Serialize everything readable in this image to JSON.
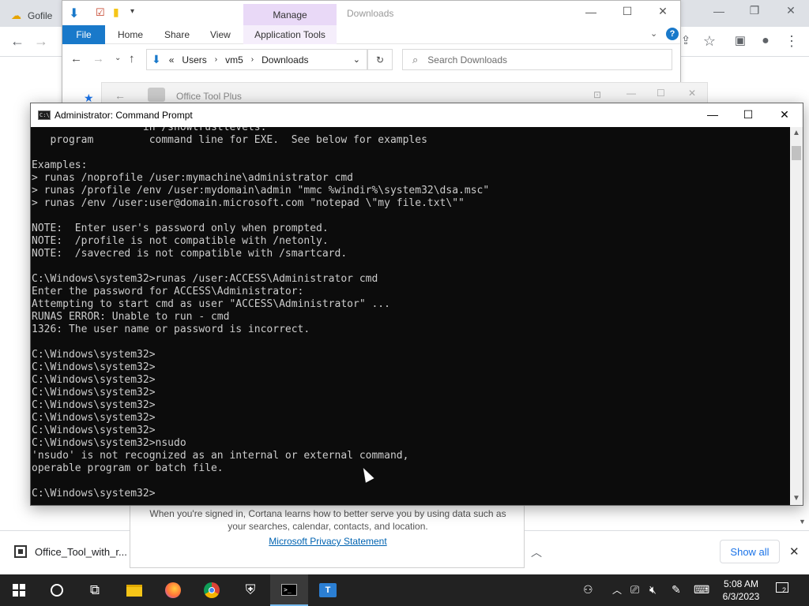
{
  "chrome": {
    "tab_title": "Gofile",
    "downloads": {
      "file_name": "Office_Tool_with_r...",
      "show_all": "Show all"
    }
  },
  "explorer": {
    "manage_label": "Manage",
    "title": "Downloads",
    "tabs": [
      "File",
      "Home",
      "Share",
      "View",
      "Application Tools"
    ],
    "breadcrumb": [
      "«",
      "Users",
      "vm5",
      "Downloads"
    ],
    "search_placeholder": "Search Downloads"
  },
  "office_tool": {
    "title": "Office Tool Plus"
  },
  "cortana": {
    "text": "When you're signed in, Cortana learns how to better serve you by using data such as your searches, calendar, contacts, and location.",
    "link": "Microsoft Privacy Statement"
  },
  "cmd": {
    "title": "Administrator: Command Prompt",
    "lines": [
      "                  in /showtrustlevels.",
      "   program         command line for EXE.  See below for examples",
      "",
      "Examples:",
      "> runas /noprofile /user:mymachine\\administrator cmd",
      "> runas /profile /env /user:mydomain\\admin \"mmc %windir%\\system32\\dsa.msc\"",
      "> runas /env /user:user@domain.microsoft.com \"notepad \\\"my file.txt\\\"\"",
      "",
      "NOTE:  Enter user's password only when prompted.",
      "NOTE:  /profile is not compatible with /netonly.",
      "NOTE:  /savecred is not compatible with /smartcard.",
      "",
      "C:\\Windows\\system32>runas /user:ACCESS\\Administrator cmd",
      "Enter the password for ACCESS\\Administrator:",
      "Attempting to start cmd as user \"ACCESS\\Administrator\" ...",
      "RUNAS ERROR: Unable to run - cmd",
      "1326: The user name or password is incorrect.",
      "",
      "C:\\Windows\\system32>",
      "C:\\Windows\\system32>",
      "C:\\Windows\\system32>",
      "C:\\Windows\\system32>",
      "C:\\Windows\\system32>",
      "C:\\Windows\\system32>",
      "C:\\Windows\\system32>",
      "C:\\Windows\\system32>nsudo",
      "'nsudo' is not recognized as an internal or external command,",
      "operable program or batch file.",
      "",
      "C:\\Windows\\system32>"
    ]
  },
  "taskbar": {
    "time": "5:08 AM",
    "date": "6/3/2023",
    "notification_count": "2",
    "apps": [
      "start-icon",
      "cortana-icon",
      "task-view-icon",
      "file-explorer-icon",
      "firefox-icon",
      "chrome-icon",
      "security-icon",
      "command-prompt-icon",
      "office-tool-icon"
    ]
  },
  "colors": {
    "cmd_bg": "#0c0c0c",
    "cmd_text": "#cccccc",
    "explorer_file_tab": "#1979ca",
    "manage_tab": "#e9d9f7",
    "taskbar": "#222222"
  }
}
